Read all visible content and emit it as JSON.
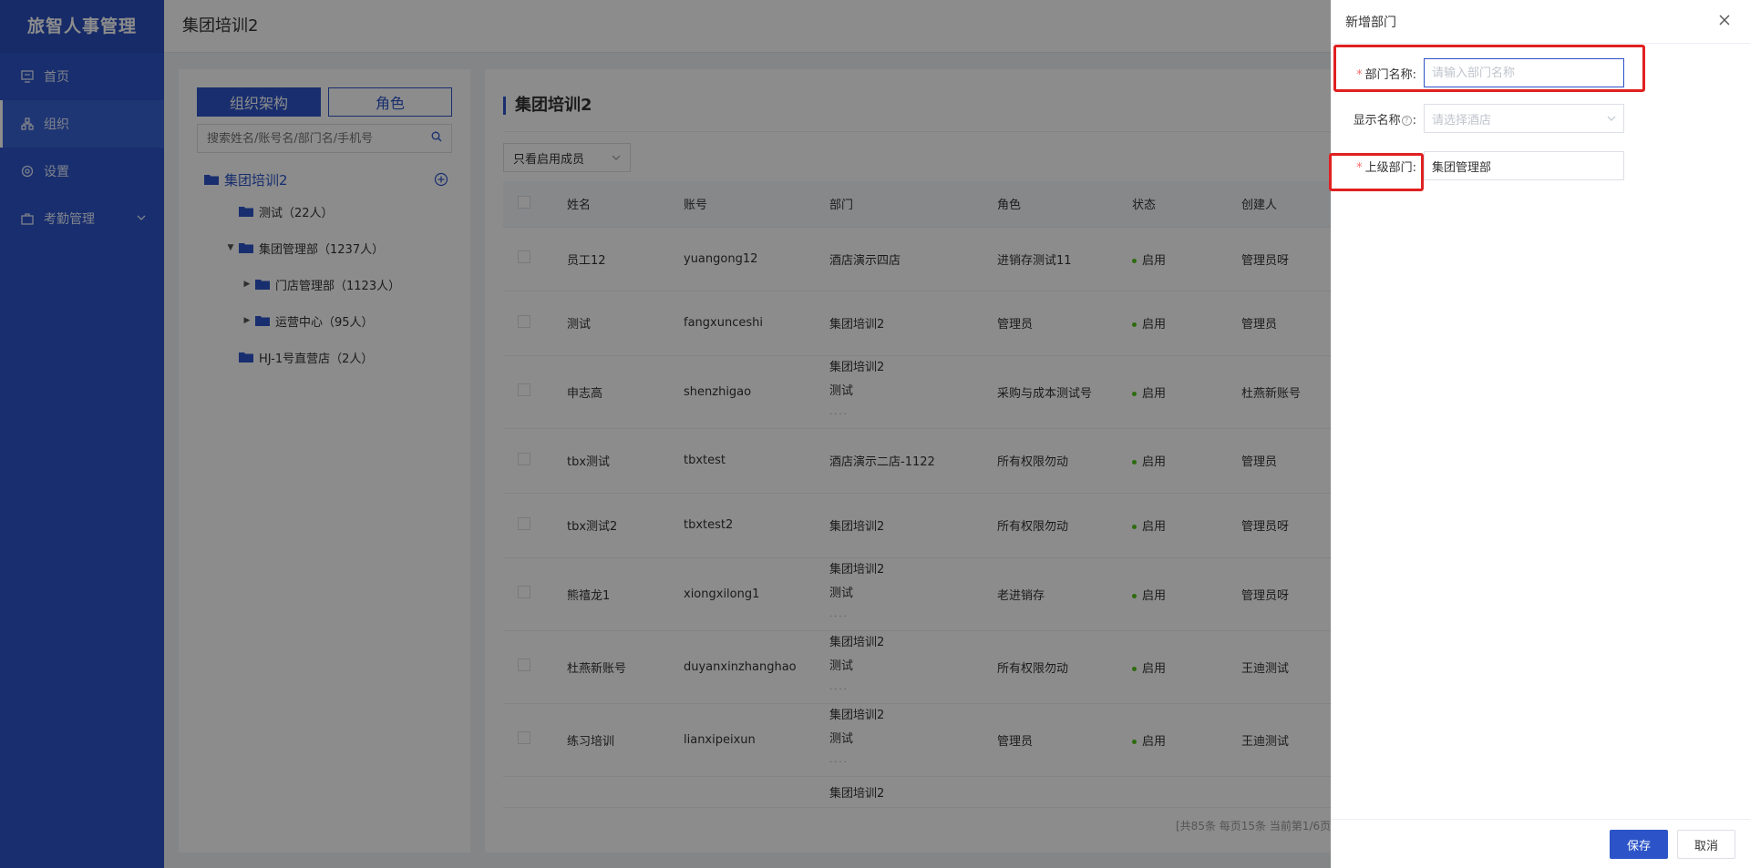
{
  "app": {
    "brand": "旅智人事管理"
  },
  "sidebar": {
    "items": [
      {
        "label": "首页",
        "icon": "monitor-icon"
      },
      {
        "label": "组织",
        "icon": "org-chart-icon",
        "active": true
      },
      {
        "label": "设置",
        "icon": "gear-icon"
      },
      {
        "label": "考勤管理",
        "icon": "briefcase-icon",
        "has_children": true
      }
    ]
  },
  "header": {
    "title": "集团培训2"
  },
  "tree_panel": {
    "tabs": [
      "组织架构",
      "角色"
    ],
    "search_placeholder": "搜索姓名/账号名/部门名/手机号",
    "root": "集团培训2",
    "nodes": [
      {
        "label": "测试（22人）",
        "level": 1
      },
      {
        "label": "集团管理部（1237人）",
        "level": 1,
        "expanded": true
      },
      {
        "label": "门店管理部（1123人）",
        "level": 2,
        "collapsed": true
      },
      {
        "label": "运营中心（95人）",
        "level": 2,
        "collapsed": true
      },
      {
        "label": "HJ-1号直营店（2人）",
        "level": 1
      }
    ]
  },
  "content": {
    "title": "集团培训2",
    "filter_label": "只看启用成员",
    "columns": [
      "姓名",
      "账号",
      "部门",
      "角色",
      "状态",
      "创建人"
    ],
    "rows": [
      {
        "name": "员工12",
        "account": "yuangong12",
        "dept": [
          "酒店演示四店"
        ],
        "role": "进销存测试11",
        "status": "启用",
        "creator": "管理员呀"
      },
      {
        "name": "测试",
        "account": "fangxunceshi",
        "dept": [
          "集团培训2"
        ],
        "role": "管理员",
        "status": "启用",
        "creator": "管理员"
      },
      {
        "name": "申志高",
        "account": "shenzhigao",
        "dept": [
          "集团培训2",
          "测试"
        ],
        "more": "····",
        "role": "采购与成本测试号",
        "status": "启用",
        "creator": "杜燕新账号"
      },
      {
        "name": "tbx测试",
        "account": "tbxtest",
        "dept": [
          "酒店演示二店-1122"
        ],
        "role": "所有权限勿动",
        "status": "启用",
        "creator": "管理员"
      },
      {
        "name": "tbx测试2",
        "account": "tbxtest2",
        "dept": [
          "集团培训2"
        ],
        "role": "所有权限勿动",
        "status": "启用",
        "creator": "管理员呀"
      },
      {
        "name": "熊禧龙1",
        "account": "xiongxilong1",
        "dept": [
          "集团培训2",
          "测试"
        ],
        "more": "····",
        "role": "老进销存",
        "status": "启用",
        "creator": "管理员呀"
      },
      {
        "name": "杜燕新账号",
        "account": "duyanxinzhanghao",
        "dept": [
          "集团培训2",
          "测试"
        ],
        "more": "····",
        "role": "所有权限勿动",
        "status": "启用",
        "creator": "王迪测试"
      },
      {
        "name": "练习培训",
        "account": "lianxipeixun",
        "dept": [
          "集团培训2",
          "测试"
        ],
        "more": "····",
        "role": "管理员",
        "status": "启用",
        "creator": "王迪测试"
      },
      {
        "name": "",
        "account": "",
        "dept": [
          "集团培训2"
        ],
        "role": "",
        "status": "",
        "creator": ""
      }
    ],
    "pager": "[共85条 每页15条 当前第1/6页]"
  },
  "drawer": {
    "title": "新增部门",
    "fields": {
      "dept_name": {
        "label": "部门名称:",
        "placeholder": "请输入部门名称",
        "required": true
      },
      "display_name": {
        "label": "显示名称",
        "help": "?",
        "colon": ":",
        "placeholder": "请选择酒店"
      },
      "parent_dept": {
        "label": "上级部门:",
        "value": "集团管理部",
        "required": true
      }
    },
    "save_label": "保存",
    "cancel_label": "取消"
  },
  "colors": {
    "primary": "#2c54c8",
    "highlight": "#e02020",
    "status_on": "#52c41a"
  }
}
